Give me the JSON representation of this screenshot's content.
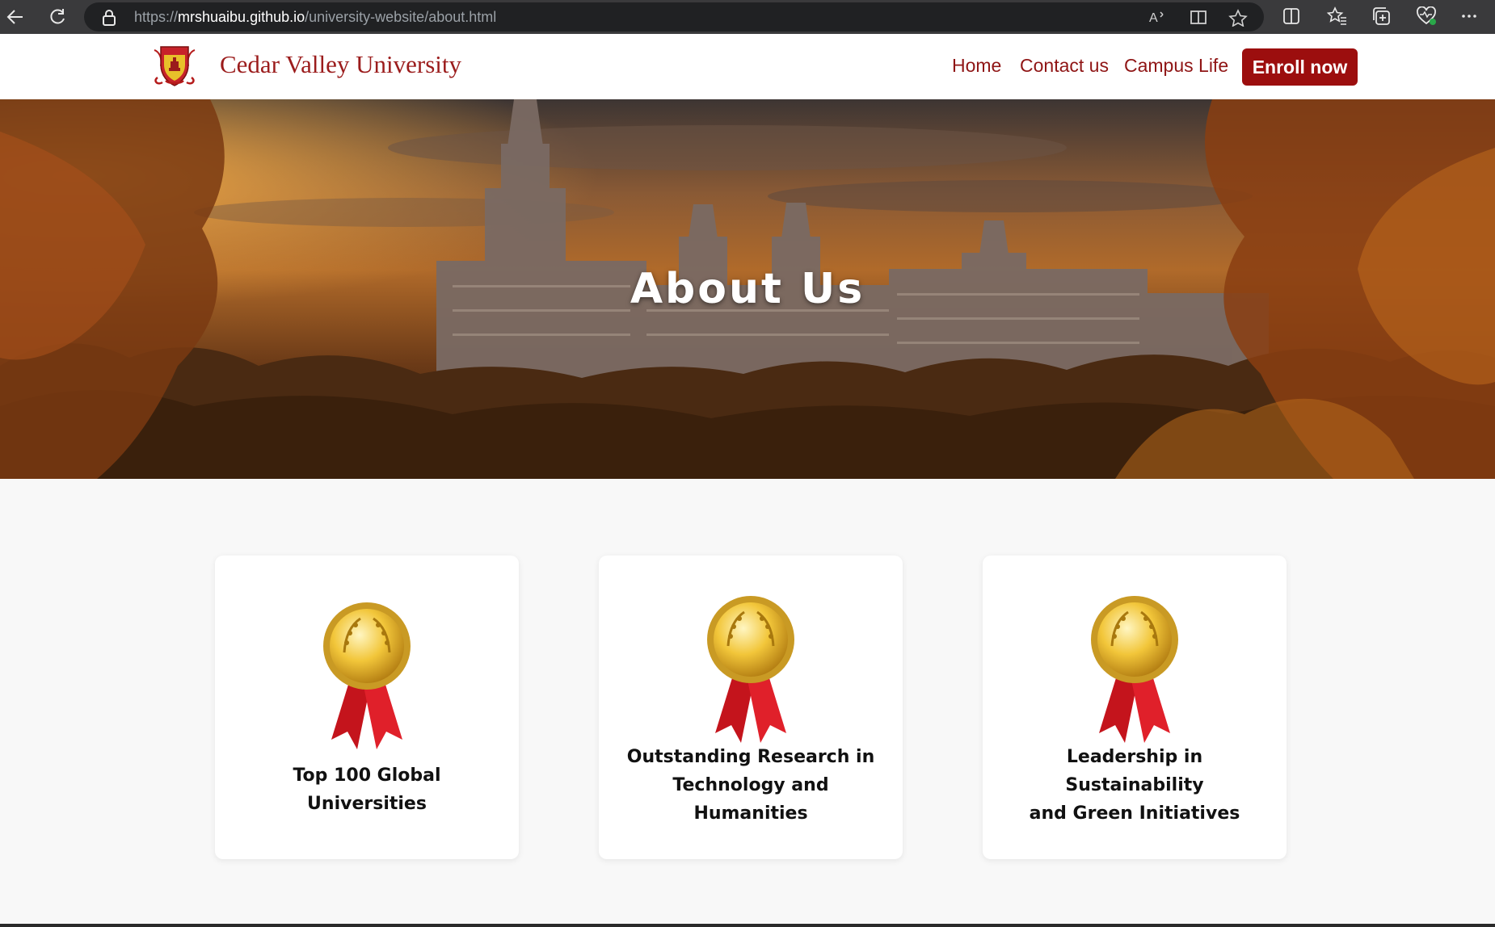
{
  "browser": {
    "url_scheme": "https://",
    "url_host": "mrshuaibu.github.io",
    "url_path": "/university-website/about.html",
    "icons": [
      "back-icon",
      "refresh-icon",
      "lock-icon",
      "read-aloud-icon",
      "immersive-reader-icon",
      "favorite-star-icon",
      "split-screen-icon",
      "favorites-icon",
      "collections-icon",
      "browser-essentials-icon",
      "more-icon"
    ]
  },
  "header": {
    "site_name": "Cedar Valley University",
    "nav": [
      {
        "label": "Home"
      },
      {
        "label": "Contact us"
      },
      {
        "label": "Campus Life"
      }
    ],
    "cta_label": "Enroll now",
    "brand_color": "#9c0e0e"
  },
  "hero": {
    "title": "About Us"
  },
  "achievements": [
    {
      "icon": "gold-medal-icon",
      "lines": [
        "Top 100 Global Universities"
      ]
    },
    {
      "icon": "gold-medal-icon",
      "lines": [
        "Outstanding Research in",
        "Technology and Humanities"
      ]
    },
    {
      "icon": "gold-medal-icon",
      "lines": [
        "Leadership in Sustainability",
        "and Green Initiatives"
      ]
    }
  ]
}
